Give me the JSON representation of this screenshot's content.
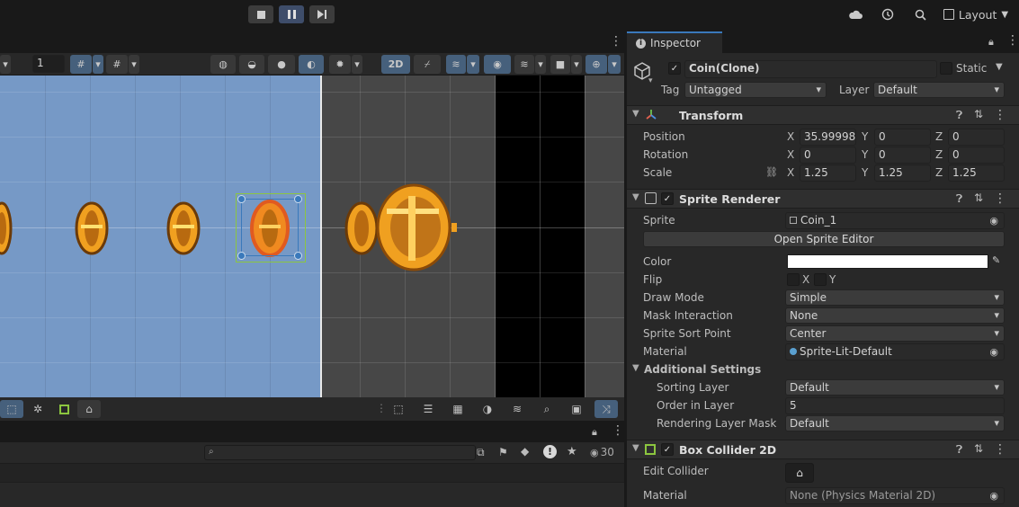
{
  "playbar": {
    "stop": "stop",
    "pause": "pause",
    "step": "step"
  },
  "topright": {
    "layout_label": "Layout"
  },
  "scene_toolbar": {
    "layer_value": "1",
    "mode_2d_label": "2D"
  },
  "console": {
    "count": "30"
  },
  "inspector": {
    "tab_label": "Inspector",
    "object_name": "Coin(Clone)",
    "static_label": "Static",
    "tag_label": "Tag",
    "tag_value": "Untagged",
    "layer_label": "Layer",
    "layer_value": "Default",
    "transform": {
      "title": "Transform",
      "position_label": "Position",
      "rotation_label": "Rotation",
      "scale_label": "Scale",
      "position": {
        "x": "35.99998",
        "y": "0",
        "z": "0"
      },
      "rotation": {
        "x": "0",
        "y": "0",
        "z": "0"
      },
      "scale": {
        "x": "1.25",
        "y": "1.25",
        "z": "1.25"
      }
    },
    "axis": {
      "x": "X",
      "y": "Y",
      "z": "Z"
    },
    "sprite_renderer": {
      "title": "Sprite Renderer",
      "sprite_label": "Sprite",
      "sprite_value": "Coin_1",
      "open_editor": "Open Sprite Editor",
      "color_label": "Color",
      "color_value": "#ffffff",
      "flip_label": "Flip",
      "flip_x": "X",
      "flip_y": "Y",
      "draw_mode_label": "Draw Mode",
      "draw_mode_value": "Simple",
      "mask_label": "Mask Interaction",
      "mask_value": "None",
      "sort_point_label": "Sprite Sort Point",
      "sort_point_value": "Center",
      "material_label": "Material",
      "material_value": "Sprite-Lit-Default",
      "additional_settings": "Additional Settings",
      "sorting_layer_label": "Sorting Layer",
      "sorting_layer_value": "Default",
      "order_label": "Order in Layer",
      "order_value": "5",
      "rendering_mask_label": "Rendering Layer Mask",
      "rendering_mask_value": "Default"
    },
    "box_collider": {
      "title": "Box Collider 2D",
      "edit_label": "Edit Collider",
      "material_label": "Material",
      "material_value": "None (Physics Material 2D)"
    }
  },
  "colors": {
    "sky": "#7699c6",
    "coin_gold": "#f0a020",
    "selection_blue": "#3a79bb",
    "collider_green": "#8cc63f"
  }
}
